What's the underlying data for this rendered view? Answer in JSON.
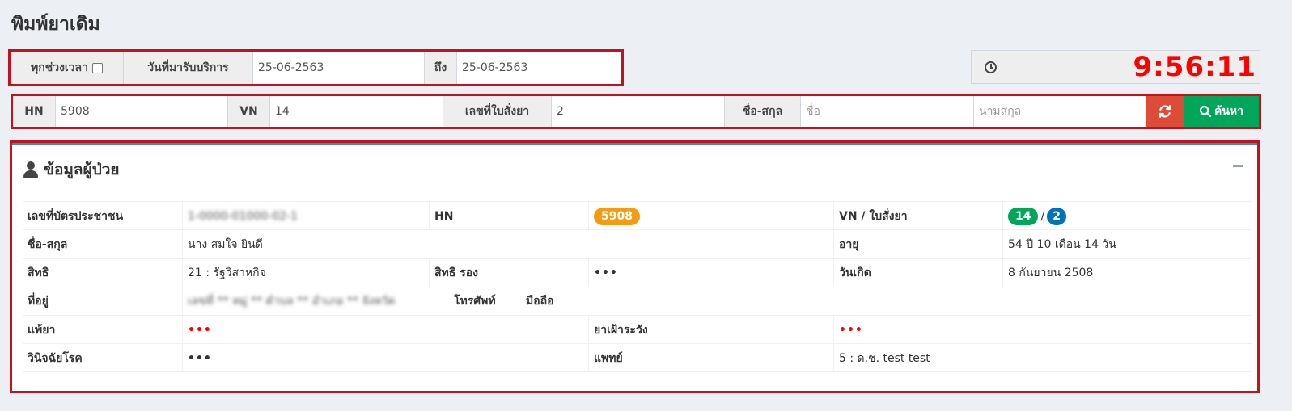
{
  "page": {
    "title": "พิมพ์ยาเดิม"
  },
  "date_filter": {
    "all_time_label": "ทุกช่วงเวลา",
    "service_date_label": "วันที่มารับบริการ",
    "from_value": "25-06-2563",
    "to_label": "ถึง",
    "to_value": "25-06-2563"
  },
  "clock": {
    "time": "9:56:11",
    "icon": "clock-icon"
  },
  "search": {
    "hn_label": "HN",
    "hn_value": "5908",
    "vn_label": "VN",
    "vn_value": "14",
    "order_label": "เลขที่ใบสั่งยา",
    "order_value": "2",
    "name_label": "ชื่อ-สกุล",
    "first_name_placeholder": "ชื่อ",
    "last_name_placeholder": "นามสกุล",
    "refresh_icon": "refresh-icon",
    "search_button_label": "ค้นหา",
    "search_icon": "search-icon"
  },
  "patient": {
    "header": "ข้อมูลผู้ป่วย",
    "id_card_label": "เลขที่บัตรประชาชน",
    "id_card_value": "1-0000-01000-02-1",
    "hn_label": "HN",
    "hn_badge": "5908",
    "vn_order_label": "VN / ใบสั่งยา",
    "vn_badge": "14",
    "slash": "/",
    "order_badge": "2",
    "name_label": "ชื่อ-สกุล",
    "name_value": "นาง สมใจ ยินดี",
    "age_label": "อายุ",
    "age_value": "54 ปี 10 เดือน 14 วัน",
    "right_label": "สิทธิ",
    "right_value": "21 : รัฐวิสาหกิจ",
    "sub_right_label": "สิทธิ รอง",
    "sub_right_value": "•••",
    "birth_label": "วันเกิด",
    "birth_value": "8 กันยายน 2508",
    "address_label": "ที่อยู่",
    "address_value": "เลขที่ ** หมู่ ** ตำบล ** อำเภอ ** จังหวัด",
    "phone_label": "โทรศัพท์",
    "mobile_label": "มือถือ",
    "allergy_label": "แพ้ยา",
    "allergy_value": "•••",
    "watch_drug_label": "ยาเฝ้าระวัง",
    "watch_drug_value": "•••",
    "diagnosis_label": "วินิจฉัยโรค",
    "diagnosis_value": "•••",
    "doctor_label": "แพทย์",
    "doctor_value": "5 : ด.ช. test test"
  },
  "colors": {
    "accent_red": "#c0121f",
    "clock_red": "#ff0000",
    "search_green": "#00a65a",
    "refresh_red": "#dd4b39",
    "badge_orange": "#f39c12",
    "badge_green": "#00a65a",
    "badge_blue": "#0073b7"
  }
}
